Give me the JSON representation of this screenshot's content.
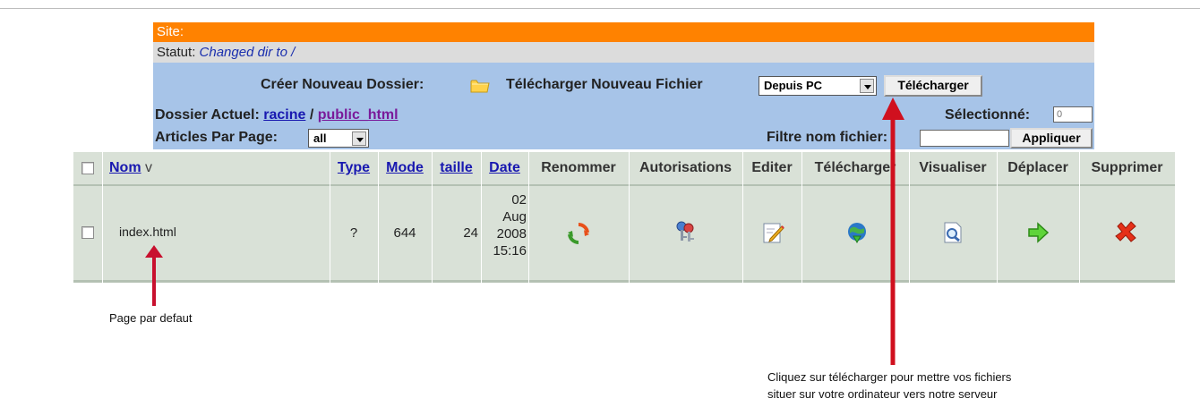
{
  "panel": {
    "site_label": "Site:",
    "status_label": "Statut:",
    "status_value": "Changed dir to /",
    "create_folder_label": "Créer Nouveau Dossier:",
    "upload_file_label": "Télécharger Nouveau Fichier",
    "upload_source": "Depuis PC",
    "upload_button": "Télécharger",
    "current_dir_label": "Dossier Actuel:",
    "root_link": "racine",
    "path_sep": "/",
    "subdir_link": "public_html",
    "selected_label": "Sélectionné:",
    "selected_value": "0",
    "items_per_page_label": "Articles Par Page:",
    "items_per_page_value": "all",
    "filter_label": "Filtre nom fichier:",
    "filter_value": "",
    "apply_button": "Appliquer"
  },
  "table": {
    "columns": {
      "name": "Nom",
      "sort_marker": "v",
      "type": "Type",
      "mode": "Mode",
      "size": "taille",
      "date": "Date",
      "rename": "Renommer",
      "perms": "Autorisations",
      "edit": "Editer",
      "download": "Télécharger",
      "view": "Visualiser",
      "move": "Déplacer",
      "delete": "Supprimer"
    },
    "rows": [
      {
        "name": "index.html",
        "type": "?",
        "mode": "644",
        "size": "24",
        "date_day": "02",
        "date_month": "Aug",
        "date_year": "2008",
        "date_time": "15:16"
      }
    ]
  },
  "annotations": {
    "default_page": "Page par defaut",
    "upload_hint_line1": "Cliquez sur télécharger pour mettre vos fichiers",
    "upload_hint_line2": "situer sur votre ordinateur vers notre serveur"
  },
  "colors": {
    "site_bar": "#ff8200",
    "status_bar": "#dcdcdc",
    "toolbar": "#a7c4e8",
    "table_bg": "#d9e1d7",
    "arrow": "#c8102e"
  }
}
